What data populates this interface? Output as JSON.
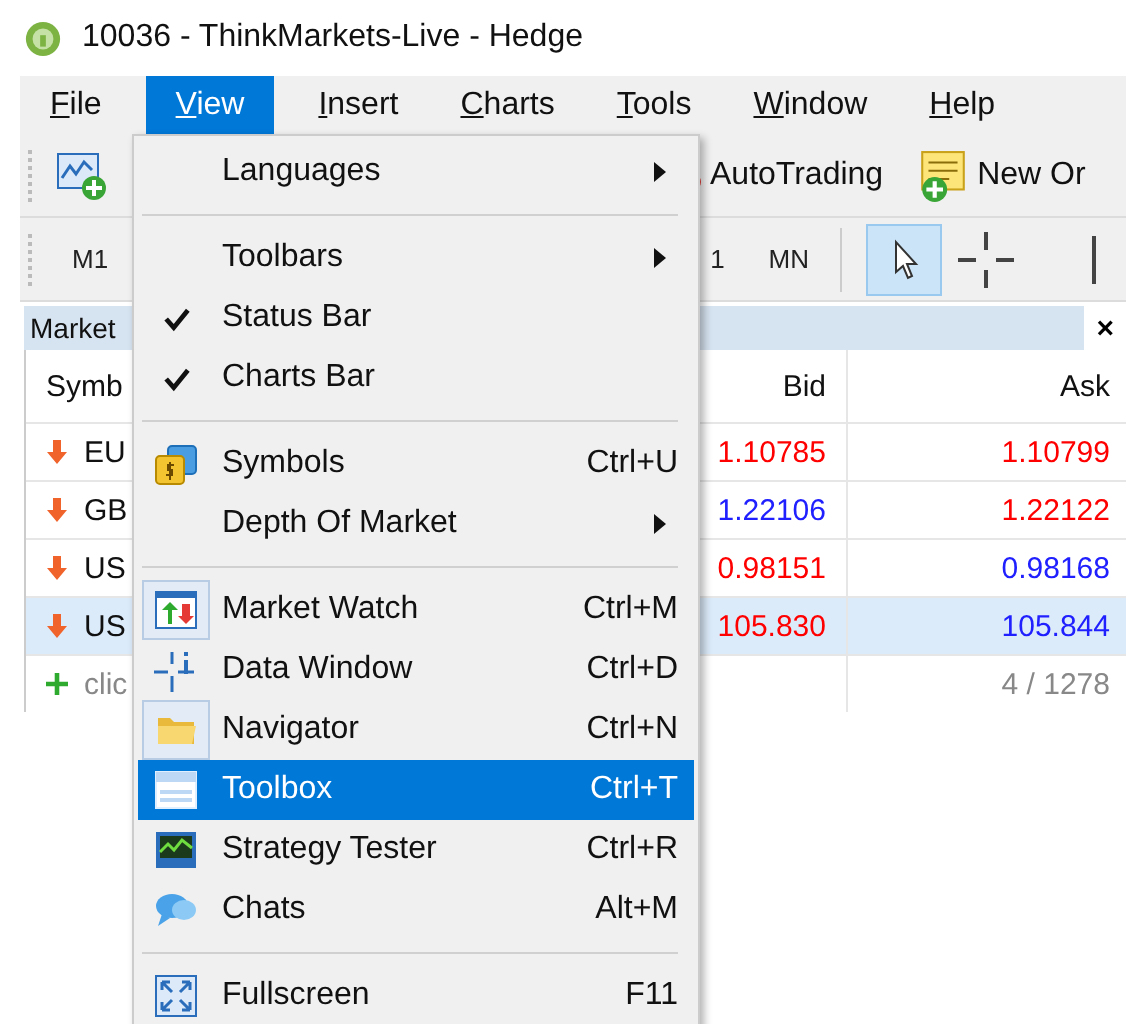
{
  "window": {
    "title": "10036 - ThinkMarkets-Live - Hedge"
  },
  "menubar": [
    {
      "label": "File",
      "selected": false
    },
    {
      "label": "View",
      "selected": true
    },
    {
      "label": "Insert",
      "selected": false
    },
    {
      "label": "Charts",
      "selected": false
    },
    {
      "label": "Tools",
      "selected": false
    },
    {
      "label": "Window",
      "selected": false
    },
    {
      "label": "Help",
      "selected": false
    }
  ],
  "toolbar": {
    "autotrading": "AutoTrading",
    "new_order": "New Or"
  },
  "timeframes": [
    {
      "label": "M1"
    },
    {
      "label": "1"
    },
    {
      "label": "MN"
    }
  ],
  "market_watch": {
    "title": "Market",
    "close": "×",
    "columns": [
      "Symb",
      "Bid",
      "Ask"
    ],
    "rows": [
      {
        "symbol": "EU",
        "selected": false,
        "bid": {
          "text": "1.10785",
          "color": "#ff0000"
        },
        "ask": {
          "text": "1.10799",
          "color": "#ff0000"
        }
      },
      {
        "symbol": "GB",
        "selected": false,
        "bid": {
          "text": "1.22106",
          "color": "#2020ff"
        },
        "ask": {
          "text": "1.22122",
          "color": "#ff0000"
        }
      },
      {
        "symbol": "US",
        "selected": false,
        "bid": {
          "text": "0.98151",
          "color": "#ff0000"
        },
        "ask": {
          "text": "0.98168",
          "color": "#2020ff"
        }
      },
      {
        "symbol": "US",
        "selected": true,
        "bid": {
          "text": "105.830",
          "color": "#ff0000"
        },
        "ask": {
          "text": "105.844",
          "color": "#2020ff"
        }
      }
    ],
    "footer": {
      "add_label": "clic",
      "count": "4 / 1278"
    }
  },
  "view_menu": [
    {
      "kind": "item",
      "label": "Languages",
      "submenu": true,
      "checked": false,
      "selected": false
    },
    {
      "kind": "separator"
    },
    {
      "kind": "item",
      "label": "Toolbars",
      "submenu": true,
      "checked": false,
      "selected": false
    },
    {
      "kind": "item",
      "label": "Status Bar",
      "checked": true,
      "selected": false
    },
    {
      "kind": "item",
      "label": "Charts Bar",
      "checked": true,
      "selected": false
    },
    {
      "kind": "separator"
    },
    {
      "kind": "item",
      "label": "Symbols",
      "shortcut": "Ctrl+U",
      "checked": false,
      "selected": false
    },
    {
      "kind": "item",
      "label": "Depth Of Market",
      "submenu": true,
      "checked": false,
      "selected": false
    },
    {
      "kind": "separator"
    },
    {
      "kind": "item",
      "label": "Market Watch",
      "shortcut": "Ctrl+M",
      "checked": true,
      "selected": false
    },
    {
      "kind": "item",
      "label": "Data Window",
      "shortcut": "Ctrl+D",
      "checked": false,
      "selected": false
    },
    {
      "kind": "item",
      "label": "Navigator",
      "shortcut": "Ctrl+N",
      "checked": true,
      "selected": false
    },
    {
      "kind": "item",
      "label": "Toolbox",
      "shortcut": "Ctrl+T",
      "checked": false,
      "selected": true
    },
    {
      "kind": "item",
      "label": "Strategy Tester",
      "shortcut": "Ctrl+R",
      "checked": false,
      "selected": false
    },
    {
      "kind": "item",
      "label": "Chats",
      "shortcut": "Alt+M",
      "checked": false,
      "selected": false
    },
    {
      "kind": "separator"
    },
    {
      "kind": "item",
      "label": "Fullscreen",
      "shortcut": "F11",
      "checked": false,
      "selected": false
    }
  ]
}
